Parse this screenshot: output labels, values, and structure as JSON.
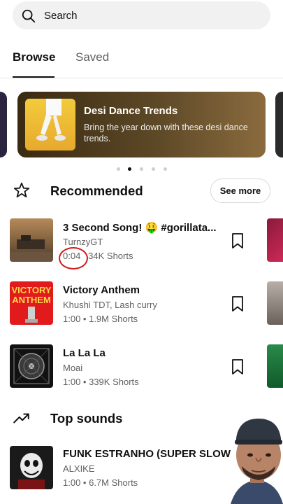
{
  "search": {
    "label": "Search"
  },
  "tabs": [
    {
      "label": "Browse",
      "active": true
    },
    {
      "label": "Saved",
      "active": false
    }
  ],
  "banner": {
    "title": "Desi Dance Trends",
    "subtitle": "Bring the year down with these desi dance trends.",
    "page_count": 5,
    "active_page": 2
  },
  "recommended": {
    "title": "Recommended",
    "icon": "star-outline-icon",
    "see_more": "See more",
    "items": [
      {
        "title": "3 Second Song! 🤑 #gorillata...",
        "artist": "TurnzyGT",
        "duration": "0:04",
        "shorts": "34K Shorts"
      },
      {
        "title": "Victory Anthem",
        "artist": "Khushi TDT, Lash curry",
        "duration": "1:00",
        "shorts": "1.9M Shorts"
      },
      {
        "title": "La La La",
        "artist": "Moai",
        "duration": "1:00",
        "shorts": "339K Shorts"
      }
    ]
  },
  "top_sounds": {
    "title": "Top sounds",
    "icon": "trending-icon",
    "items": [
      {
        "title": "FUNK ESTRANHO (SUPER SLOWED)",
        "artist": "ALXIKE",
        "duration": "1:00",
        "shorts": "6.7M Shorts"
      }
    ]
  },
  "thumb_art": {
    "victory_line1": "VICTORY",
    "victory_line2": "ANTHEM"
  },
  "colors": {
    "accent": "#0f0f0f",
    "annotation": "#d11a1a"
  }
}
